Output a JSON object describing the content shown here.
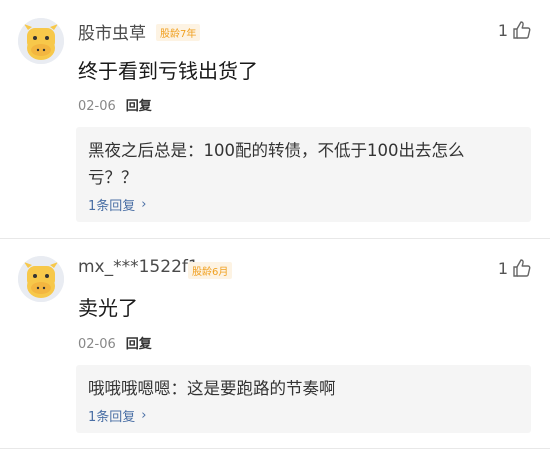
{
  "comments": [
    {
      "username": "股市虫草",
      "badge": "股龄7年",
      "likes": "1",
      "content": "终于看到亏钱出货了",
      "date": "02-06",
      "reply_label": "回复",
      "reply": {
        "author": "黑夜之后总是",
        "text": "：100配的转债，不低于100出去怎么亏？？",
        "line1": "黑夜之后总是：100配的转债，不低于100出去怎么",
        "line2": "亏？？",
        "count": "1条回复",
        "arrow": "›"
      }
    },
    {
      "username": "mx_***1522f1",
      "badge": "股龄6月",
      "likes": "1",
      "content": "卖光了",
      "date": "02-06",
      "reply_label": "回复",
      "reply": {
        "line1": "哦哦哦嗯嗯：这是要跑路的节奏啊",
        "count": "1条回复",
        "arrow": "›"
      }
    }
  ],
  "icons": {
    "like": "thumbs-up-icon",
    "avatar": "cartoon-cow-avatar",
    "arrow": "chevron-right-icon"
  },
  "colors": {
    "badge": "#f0a020",
    "reply_count": "#4a6fa5",
    "reply_bg": "#f5f5f5"
  }
}
